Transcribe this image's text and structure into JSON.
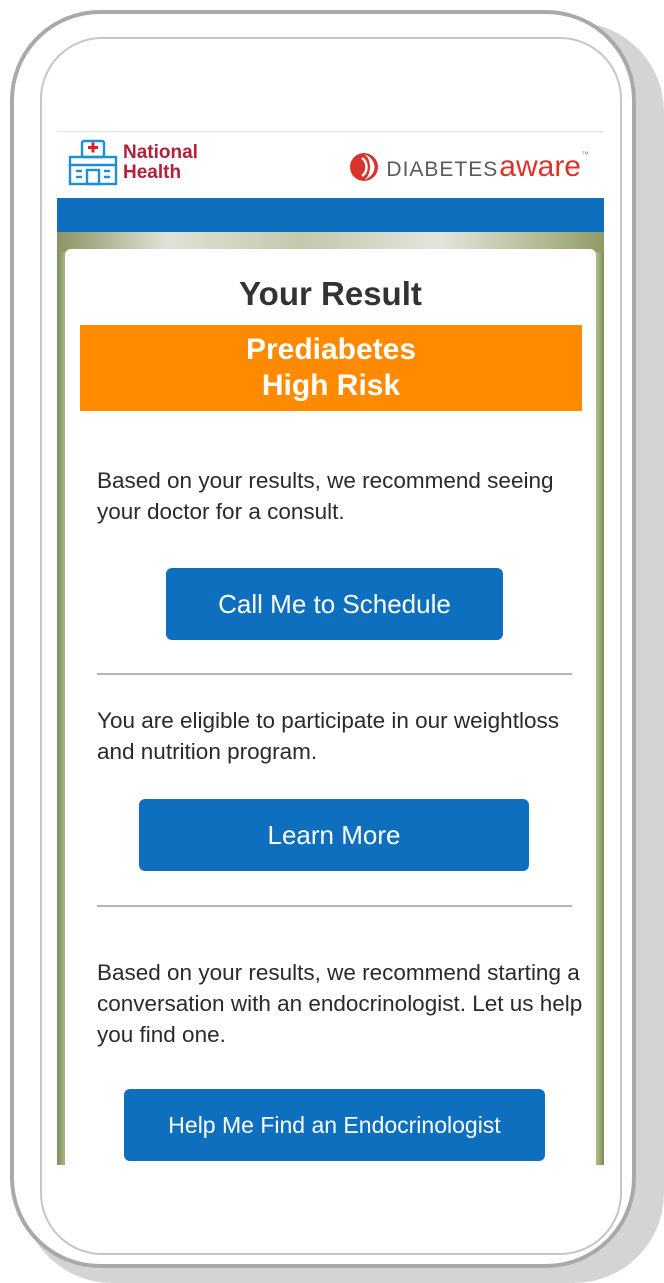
{
  "header": {
    "brand_line1": "National",
    "brand_line2": "Health",
    "partner_prefix": "DIABETES",
    "partner_suffix": "aware",
    "partner_tm": "™"
  },
  "result": {
    "title": "Your Result",
    "risk_line1": "Prediabetes",
    "risk_line2": "High Risk"
  },
  "sections": [
    {
      "text": "Based on your results, we recommend seeing your doctor for a consult.",
      "button": "Call Me to Schedule"
    },
    {
      "text": "You are eligible to participate in our weightloss and nutrition program.",
      "button": "Learn More"
    },
    {
      "text": "Based on your results, we recommend starting a conversation with an endocrinologist. Let us help you find one.",
      "button": "Help Me Find an Endocrinologist"
    }
  ],
  "colors": {
    "primary_blue": "#0d6fbd",
    "risk_orange": "#ff8a00",
    "brand_red": "#b0213a",
    "aware_red": "#d8332c"
  },
  "icons": {
    "hospital": "hospital-icon",
    "diabetes_aware_mark": "diabetes-aware-mark"
  }
}
